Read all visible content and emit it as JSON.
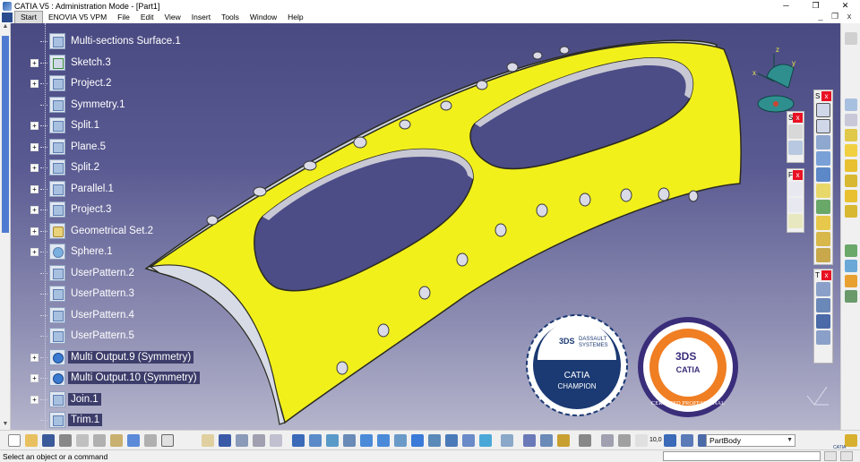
{
  "window": {
    "title": "CATIA V5 : Administration Mode - [Part1]",
    "controls": [
      "─",
      "❐",
      "✕"
    ]
  },
  "menubar": {
    "items": [
      "Start",
      "ENOVIA V5 VPM",
      "File",
      "Edit",
      "View",
      "Insert",
      "Tools",
      "Window",
      "Help"
    ],
    "mdi_controls": [
      "_",
      "❐",
      "x"
    ]
  },
  "tree": {
    "items": [
      {
        "label": "Multi-sections Surface.1",
        "icon": "multi-sections-surface-icon",
        "expand": false,
        "highlight": false
      },
      {
        "label": "Sketch.3",
        "icon": "sketch-icon",
        "expand": true,
        "highlight": false
      },
      {
        "label": "Project.2",
        "icon": "project-icon",
        "expand": true,
        "highlight": false
      },
      {
        "label": "Symmetry.1",
        "icon": "symmetry-icon",
        "expand": false,
        "highlight": false
      },
      {
        "label": "Split.1",
        "icon": "split-icon",
        "expand": true,
        "highlight": false
      },
      {
        "label": "Plane.5",
        "icon": "plane-icon",
        "expand": true,
        "highlight": false
      },
      {
        "label": "Split.2",
        "icon": "split-icon",
        "expand": true,
        "highlight": false
      },
      {
        "label": "Parallel.1",
        "icon": "parallel-icon",
        "expand": true,
        "highlight": false
      },
      {
        "label": "Project.3",
        "icon": "project-icon",
        "expand": true,
        "highlight": false
      },
      {
        "label": "Geometrical Set.2",
        "icon": "geometrical-set-icon",
        "expand": true,
        "highlight": false
      },
      {
        "label": "Sphere.1",
        "icon": "sphere-icon",
        "expand": true,
        "highlight": false
      },
      {
        "label": "UserPattern.2",
        "icon": "user-pattern-icon",
        "expand": false,
        "highlight": false
      },
      {
        "label": "UserPattern.3",
        "icon": "user-pattern-icon",
        "expand": false,
        "highlight": false
      },
      {
        "label": "UserPattern.4",
        "icon": "user-pattern-icon",
        "expand": false,
        "highlight": false
      },
      {
        "label": "UserPattern.5",
        "icon": "user-pattern-icon",
        "expand": false,
        "highlight": false
      },
      {
        "label": "Multi Output.9 (Symmetry)",
        "icon": "multi-output-icon",
        "expand": true,
        "highlight": true
      },
      {
        "label": "Multi Output.10 (Symmetry)",
        "icon": "multi-output-icon",
        "expand": true,
        "highlight": true
      },
      {
        "label": "Join.1",
        "icon": "join-icon",
        "expand": true,
        "highlight": true
      },
      {
        "label": "Trim.1",
        "icon": "trim-icon",
        "expand": false,
        "highlight": true
      }
    ]
  },
  "floating_toolbars": {
    "a": {
      "letter": "S",
      "close": "x"
    },
    "b": {
      "letter": "S",
      "close": "x"
    },
    "c": {
      "letter": "F",
      "close": "x"
    },
    "d": {
      "letter": "T",
      "close": "x"
    }
  },
  "compass": {
    "axes": [
      "x",
      "y",
      "z"
    ]
  },
  "badges": {
    "champion": {
      "brand_line1": "DASSAULT",
      "brand_line2": "SYSTEMES",
      "product": "CATIA",
      "title": "CHAMPION"
    },
    "certified": {
      "product": "CATIA",
      "ring_text": "CERTIFIED PROFESSIONAL"
    }
  },
  "toolbar": {
    "scale_label": "10,0",
    "partbody_select": "PartBody",
    "brand": "CATIA"
  },
  "status": {
    "text": "Select an object or a command"
  },
  "colors": {
    "part_fill": "#f2f01a",
    "part_edge": "#2a2a20",
    "background_top": "#4a4a82",
    "background_bottom": "#b5b5cc",
    "highlight_row": "#3d3d6b",
    "badge_navy": "#1b3a73",
    "badge_orange": "#f07e23",
    "badge_purple": "#3a2d7a"
  }
}
